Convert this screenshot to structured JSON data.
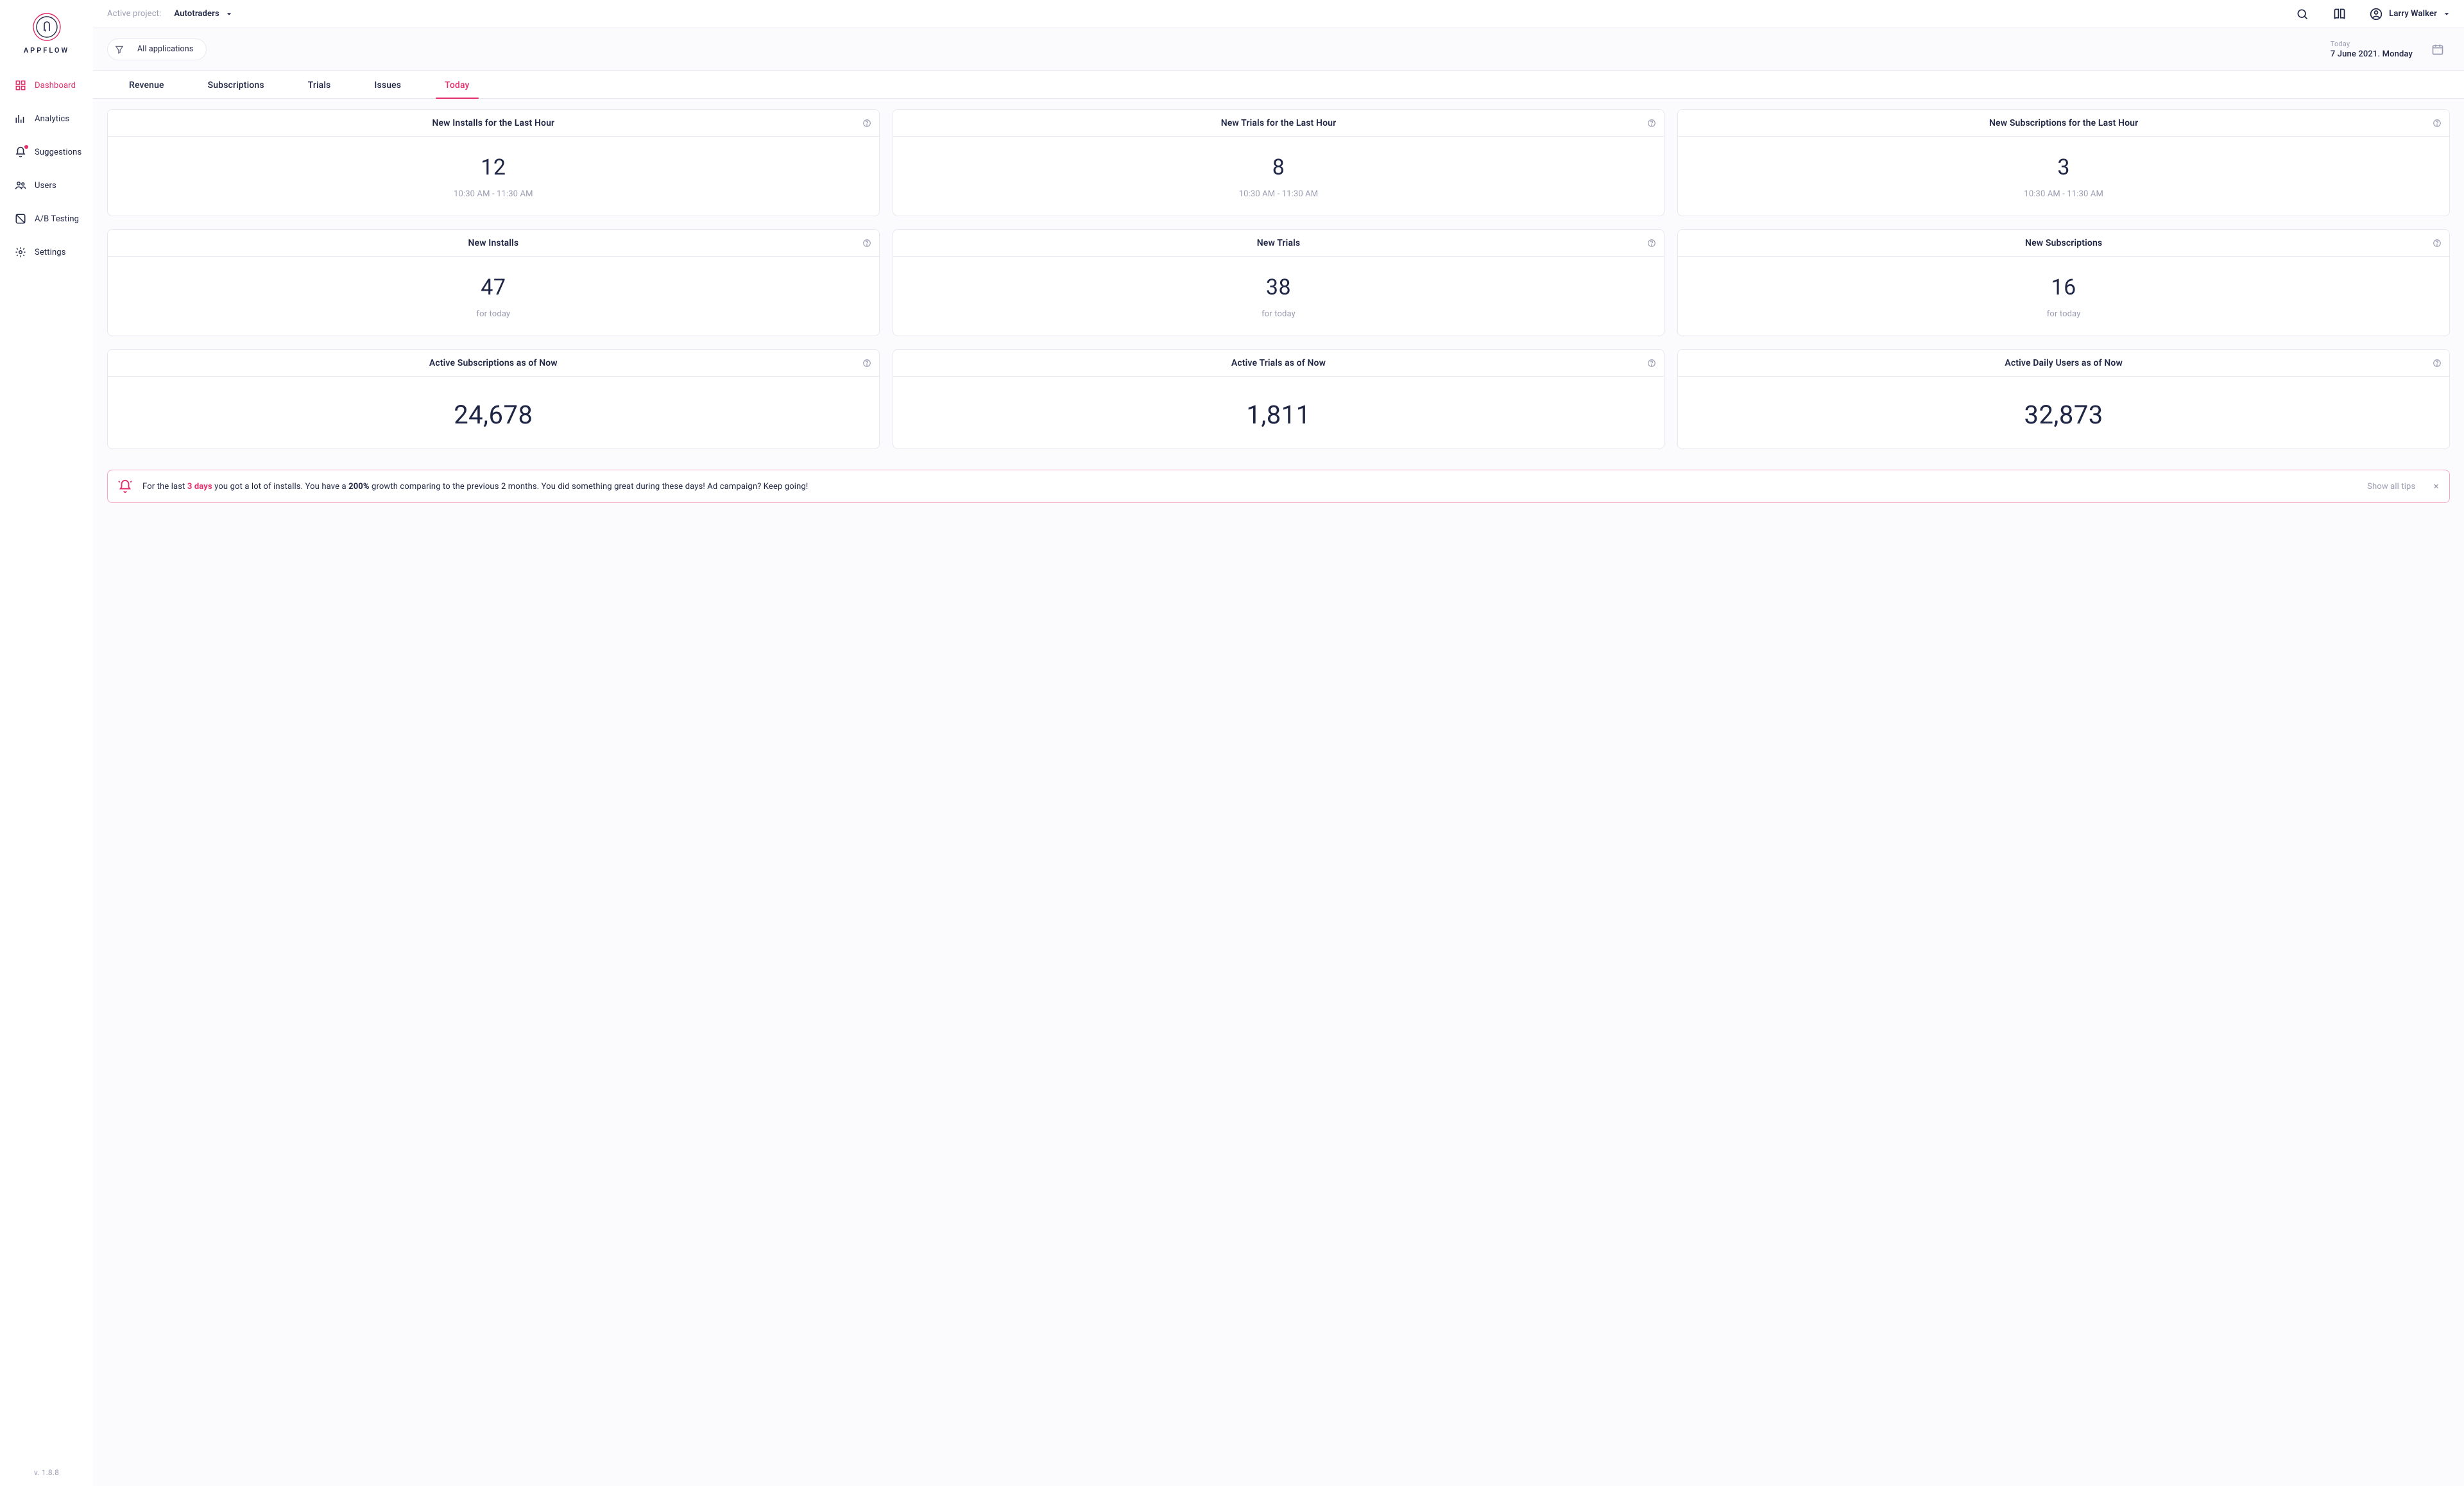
{
  "brand": {
    "name": "APPFLOW",
    "version": "v. 1.8.8"
  },
  "header": {
    "project_label": "Active project:",
    "project_name": "Autotraders",
    "user_name": "Larry Walker"
  },
  "filter": {
    "chip_label": "All applications"
  },
  "date": {
    "label": "Today",
    "value": "7 June 2021. Monday"
  },
  "sidebar": {
    "items": [
      {
        "label": "Dashboard"
      },
      {
        "label": "Analytics"
      },
      {
        "label": "Suggestions"
      },
      {
        "label": "Users"
      },
      {
        "label": "A/B Testing"
      },
      {
        "label": "Settings"
      }
    ]
  },
  "tabs": [
    {
      "label": "Revenue"
    },
    {
      "label": "Subscriptions"
    },
    {
      "label": "Trials"
    },
    {
      "label": "Issues"
    },
    {
      "label": "Today"
    }
  ],
  "cards": [
    {
      "title": "New Installs for the Last Hour",
      "value": "12",
      "sub": "10:30 AM - 11:30 AM"
    },
    {
      "title": "New Trials for the Last Hour",
      "value": "8",
      "sub": "10:30 AM - 11:30 AM"
    },
    {
      "title": "New Subscriptions for the Last Hour",
      "value": "3",
      "sub": "10:30 AM - 11:30 AM"
    },
    {
      "title": "New Installs",
      "value": "47",
      "sub": "for today"
    },
    {
      "title": "New Trials",
      "value": "38",
      "sub": "for today"
    },
    {
      "title": "New Subscriptions",
      "value": "16",
      "sub": "for today"
    },
    {
      "title": "Active Subscriptions as of Now",
      "value": "24,678",
      "sub": ""
    },
    {
      "title": "Active Trials as of Now",
      "value": "1,811",
      "sub": ""
    },
    {
      "title": "Active Daily Users as of Now",
      "value": "32,873",
      "sub": ""
    }
  ],
  "tip": {
    "prefix": "For the last ",
    "days": "3 days",
    "mid1": " you got a lot of installs. You have a ",
    "growth": "200%",
    "mid2": " growth comparing to the previous 2 months. You did something great during these days! Ad campaign? Keep going!",
    "show_all": "Show all tips"
  }
}
